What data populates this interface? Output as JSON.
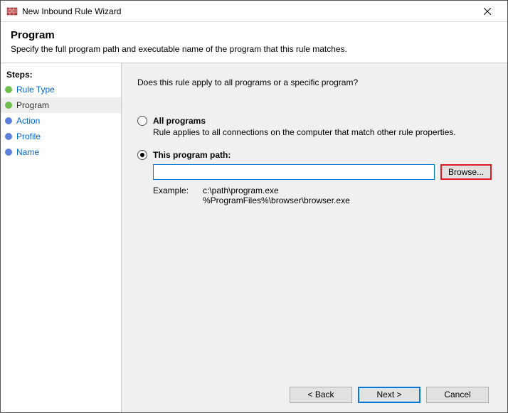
{
  "window": {
    "title": "New Inbound Rule Wizard"
  },
  "header": {
    "title": "Program",
    "subtitle": "Specify the full program path and executable name of the program that this rule matches."
  },
  "sidebar": {
    "heading": "Steps:",
    "items": [
      {
        "label": "Rule Type",
        "state": "visited"
      },
      {
        "label": "Program",
        "state": "current"
      },
      {
        "label": "Action",
        "state": "pending"
      },
      {
        "label": "Profile",
        "state": "pending"
      },
      {
        "label": "Name",
        "state": "pending"
      }
    ]
  },
  "main": {
    "question": "Does this rule apply to all programs or a specific program?",
    "option_all": {
      "label": "All programs",
      "desc": "Rule applies to all connections on the computer that match other rule properties."
    },
    "option_path": {
      "label": "This program path:",
      "input_value": "",
      "browse_label": "Browse...",
      "example_label": "Example:",
      "example_text": "c:\\path\\program.exe\n%ProgramFiles%\\browser\\browser.exe"
    }
  },
  "footer": {
    "back": "< Back",
    "next": "Next >",
    "cancel": "Cancel"
  }
}
